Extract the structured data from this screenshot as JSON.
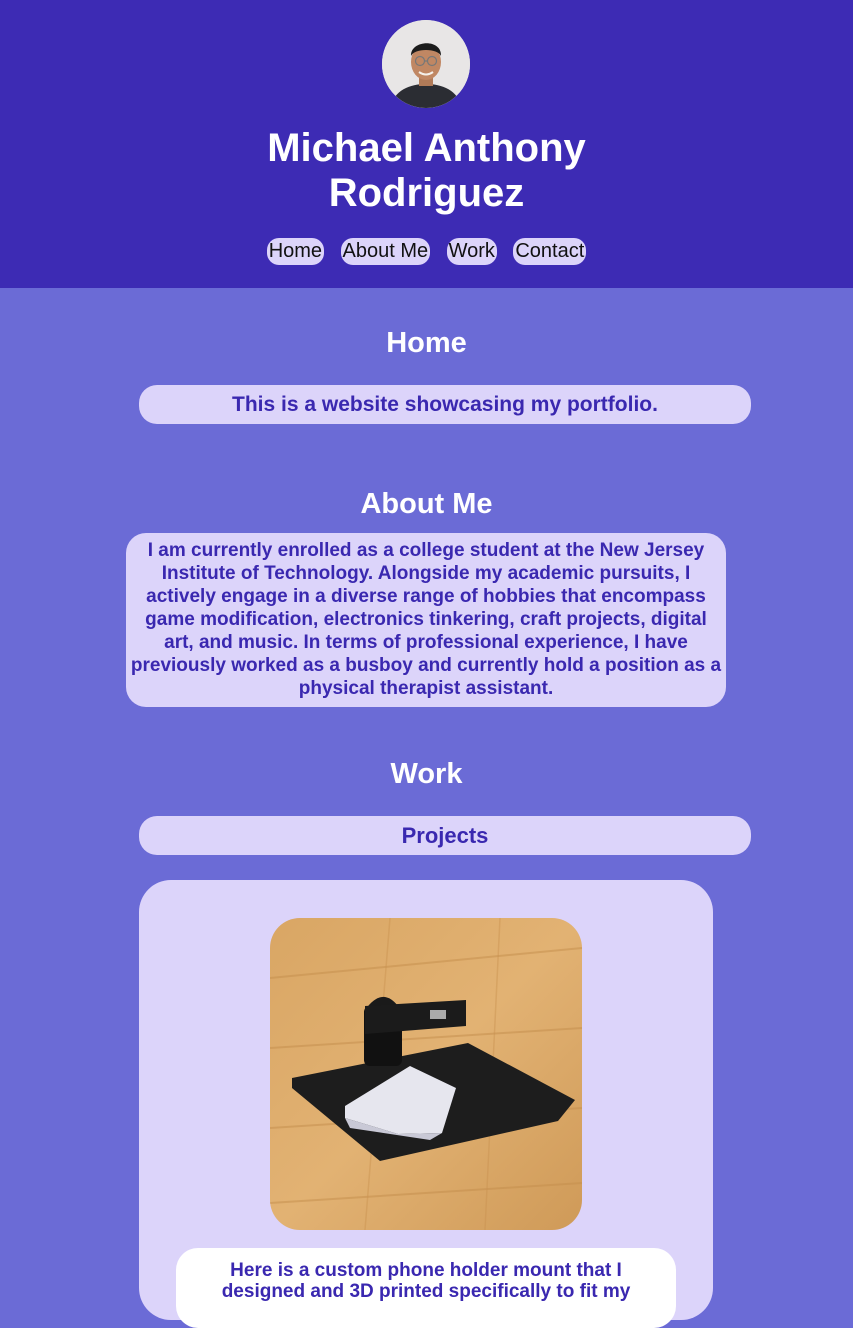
{
  "header": {
    "name_line1": "Michael Anthony",
    "name_line2": "Rodriguez"
  },
  "nav": {
    "items": [
      "Home",
      "About Me",
      "Work",
      "Contact"
    ]
  },
  "home": {
    "title": "Home",
    "tagline": "This is a website showcasing my portfolio."
  },
  "about": {
    "title": "About Me",
    "text": "I am currently enrolled as a college student at the New Jersey Institute of Technology. Alongside my academic pursuits, I actively engage in a diverse range of hobbies that encompass game modification, electronics tinkering, craft projects, digital art, and music. In terms of professional experience, I have previously worked as a busboy and currently hold a position as a physical therapist assistant."
  },
  "work": {
    "title": "Work",
    "projects_label": "Projects",
    "project": {
      "description": "Here is a custom phone holder mount that I designed and 3D printed specifically to fit my"
    }
  }
}
